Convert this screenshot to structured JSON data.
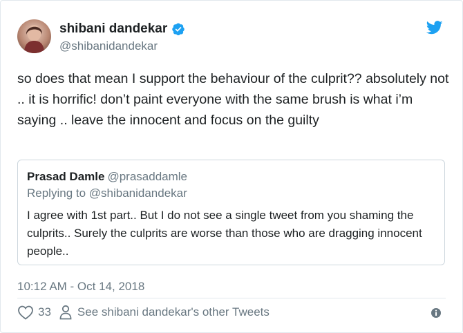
{
  "author": {
    "display_name": "shibani dandekar",
    "handle": "@shibanidandekar"
  },
  "tweet": {
    "text": "so does that mean I support the behaviour of the culprit?? absolutely not .. it is horrific! don’t paint everyone with the same brush is what i’m saying .. leave the innocent and focus on the guilty",
    "timestamp": "10:12 AM - Oct 14, 2018"
  },
  "quoted_tweet": {
    "display_name": "Prasad Damle",
    "handle": "@prasaddamle",
    "replying_to": "Replying to @shibanidandekar",
    "text": "I agree with 1st part.. But I do not see a single tweet from you shaming the culprits.. Surely the culprits are worse than those who are dragging innocent people.."
  },
  "actions": {
    "like_count": "33",
    "other_tweets_label": "See shibani dandekar's other Tweets"
  },
  "colors": {
    "brand_blue": "#1da1f2",
    "secondary_text": "#697882",
    "primary_text": "#1c2022",
    "border": "#e1e8ed"
  },
  "icons": [
    "avatar",
    "verified-badge-icon",
    "twitter-bird-icon",
    "heart-icon",
    "person-icon",
    "info-icon"
  ]
}
